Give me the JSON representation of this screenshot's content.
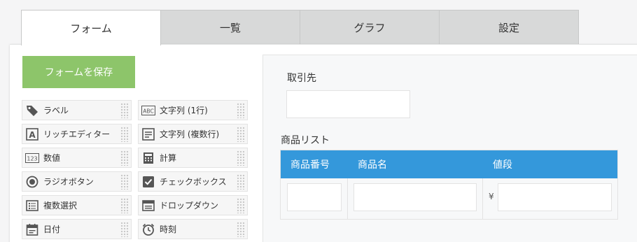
{
  "tabs": [
    {
      "label": "フォーム",
      "active": true
    },
    {
      "label": "一覧",
      "active": false
    },
    {
      "label": "グラフ",
      "active": false
    },
    {
      "label": "設定",
      "active": false
    }
  ],
  "save_button": {
    "label": "フォームを保存"
  },
  "palette": [
    {
      "label": "ラベル",
      "icon": "tag-icon"
    },
    {
      "label": "文字列 (1行)",
      "icon": "abc-text-icon"
    },
    {
      "label": "リッチエディター",
      "icon": "rich-editor-icon"
    },
    {
      "label": "文字列 (複数行)",
      "icon": "multiline-text-icon"
    },
    {
      "label": "数値",
      "icon": "number-123-icon"
    },
    {
      "label": "計算",
      "icon": "calculator-icon"
    },
    {
      "label": "ラジオボタン",
      "icon": "radio-button-icon"
    },
    {
      "label": "チェックボックス",
      "icon": "checkbox-icon"
    },
    {
      "label": "複数選択",
      "icon": "multi-select-icon"
    },
    {
      "label": "ドロップダウン",
      "icon": "dropdown-icon"
    },
    {
      "label": "日付",
      "icon": "calendar-icon"
    },
    {
      "label": "時刻",
      "icon": "clock-icon"
    }
  ],
  "form": {
    "field1_label": "取引先",
    "table_label": "商品リスト",
    "table_columns": [
      "商品番号",
      "商品名",
      "値段"
    ],
    "currency_symbol": "¥"
  },
  "colors": {
    "accent_blue": "#3498db",
    "save_green": "#8dc56a",
    "tab_inactive": "#d8d9d9"
  }
}
